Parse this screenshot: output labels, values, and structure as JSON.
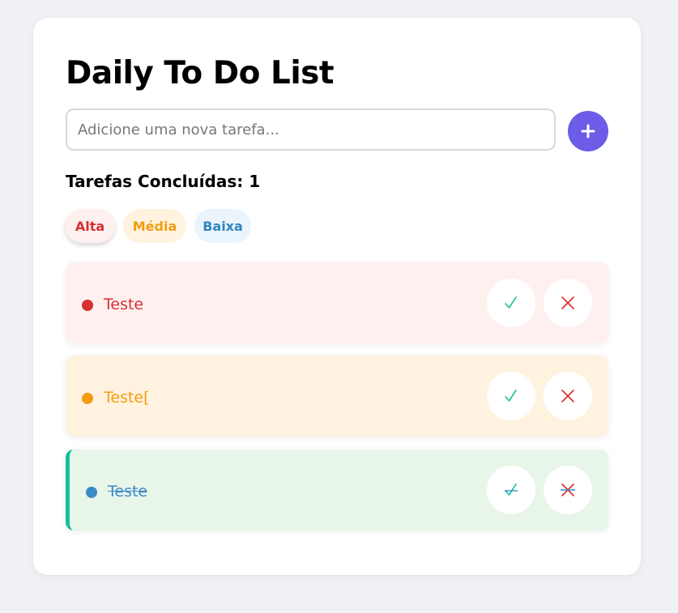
{
  "app": {
    "title": "Daily To Do List"
  },
  "input": {
    "placeholder": "Adicione uma nova tarefa...",
    "value": ""
  },
  "add_button": {
    "icon": "plus-icon"
  },
  "summary": {
    "completed_text": "Tarefas Concluídas: 1"
  },
  "filters": [
    {
      "label": "Alta",
      "color": "#d63031",
      "active": true
    },
    {
      "label": "Média",
      "color": "#f39c12",
      "active": false
    },
    {
      "label": "Baixa",
      "color": "#2e86c1",
      "active": false
    }
  ],
  "tasks": [
    {
      "text": "Teste",
      "priority": "Alta",
      "completed": false,
      "color": "#d63031"
    },
    {
      "text": "Teste[",
      "priority": "Média",
      "completed": false,
      "color": "#f39c12"
    },
    {
      "text": "Teste",
      "priority": "Baixa",
      "completed": true,
      "color": "#3d8bc6"
    }
  ],
  "task_actions": {
    "complete_icon": "check-icon",
    "delete_icon": "close-icon"
  },
  "colors": {
    "accent": "#6c5ce7",
    "completed_border": "#1abc9c"
  }
}
